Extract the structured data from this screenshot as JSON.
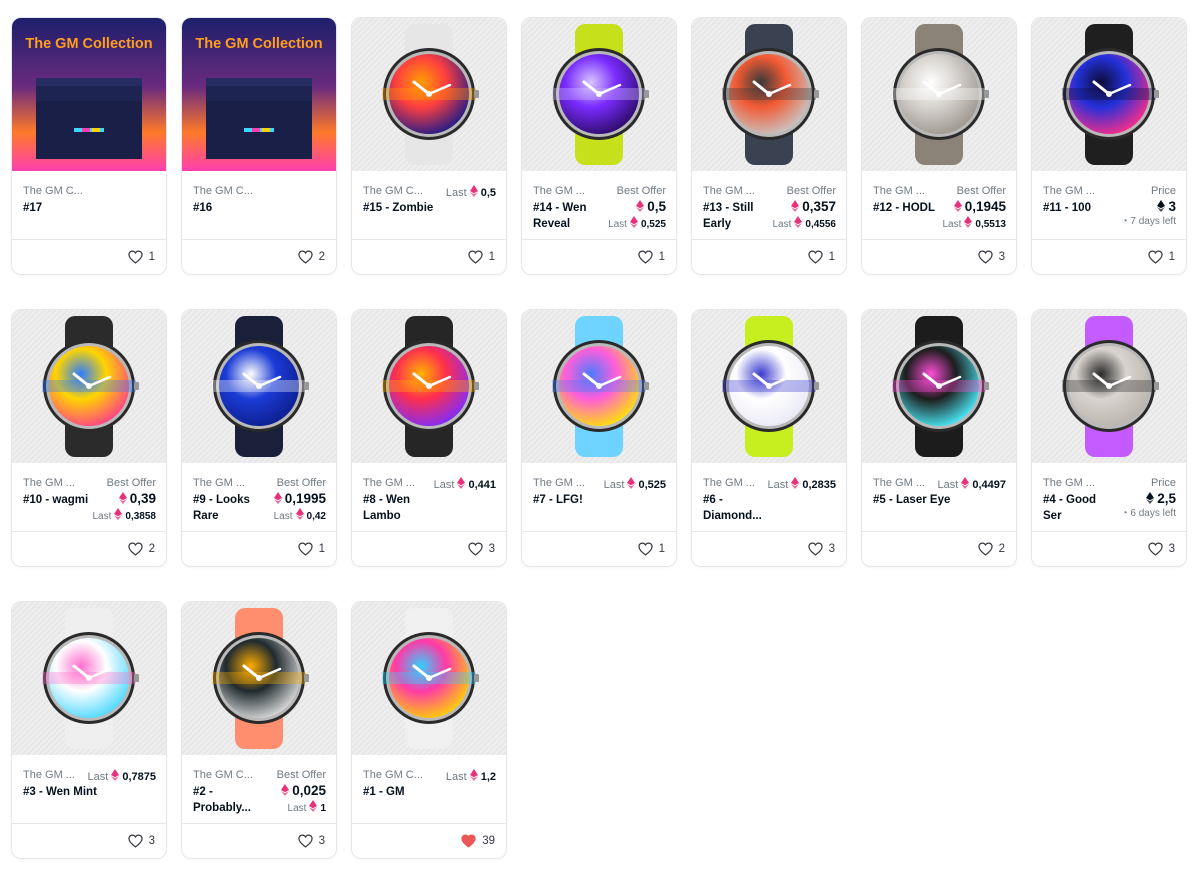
{
  "cards": [
    {
      "collection": "The GM C...",
      "name": "#17",
      "kind": "box",
      "box_title": "The GM Collection",
      "likes": "1",
      "liked": false
    },
    {
      "collection": "The GM C...",
      "name": "#16",
      "kind": "box",
      "box_title": "The GM Collection",
      "likes": "2",
      "liked": false
    },
    {
      "collection": "The GM C...",
      "name": "#15 - Zombie",
      "kind": "watch",
      "strap": "#e6e6e6",
      "dial": [
        "#ff3f3f",
        "#1b1b8a",
        "#ff9d00"
      ],
      "last_label": "Last",
      "last_value": "0,5",
      "likes": "1",
      "liked": false
    },
    {
      "collection": "The GM ...",
      "name": "#14 - Wen Reveal",
      "kind": "watch",
      "strap": "#c6e11b",
      "dial": [
        "#7a2cff",
        "#2b0a66",
        "#d7c6ff"
      ],
      "offer_label": "Best Offer",
      "price": "0,5",
      "last_label": "Last",
      "last_value": "0,525",
      "likes": "1",
      "liked": false
    },
    {
      "collection": "The GM ...",
      "name": "#13 - Still Early",
      "kind": "watch",
      "strap": "#3a4150",
      "dial": [
        "#f25a33",
        "#c7c7c7",
        "#3a3a3a"
      ],
      "offer_label": "Best Offer",
      "price": "0,357",
      "last_label": "Last",
      "last_value": "0,4556",
      "likes": "1",
      "liked": false
    },
    {
      "collection": "The GM ...",
      "name": "#12 - HODL",
      "kind": "watch",
      "strap": "#8b8377",
      "dial": [
        "#d7d3cf",
        "#9b958d",
        "#ffffff"
      ],
      "offer_label": "Best Offer",
      "price": "0,1945",
      "last_label": "Last",
      "last_value": "0,5513",
      "likes": "3",
      "liked": false
    },
    {
      "collection": "The GM ...",
      "name": "#11 - 100",
      "kind": "watch",
      "strap": "#1f1f1f",
      "dial": [
        "#2330d9",
        "#ff2d87",
        "#0d0d3a"
      ],
      "offer_label": "Price",
      "price": "3",
      "time_left": "7 days left",
      "likes": "1",
      "liked": false
    },
    {
      "collection": "The GM ...",
      "name": "#10 - wagmi",
      "kind": "watch",
      "strap": "#2b2b2b",
      "dial": [
        "#ffd500",
        "#ff3d8a",
        "#2c7cff"
      ],
      "offer_label": "Best Offer",
      "price": "0,39",
      "last_label": "Last",
      "last_value": "0,3858",
      "likes": "2",
      "liked": false
    },
    {
      "collection": "The GM ...",
      "name": "#9 - Looks Rare",
      "kind": "watch",
      "strap": "#1a1f3a",
      "dial": [
        "#1b3bd6",
        "#0c1e8c",
        "#ffffff"
      ],
      "offer_label": "Best Offer",
      "price": "0,1995",
      "last_label": "Last",
      "last_value": "0,42",
      "likes": "1",
      "liked": false
    },
    {
      "collection": "The GM ...",
      "name": "#8 - Wen Lambo",
      "kind": "watch",
      "strap": "#262626",
      "dial": [
        "#ff2e4d",
        "#7d2cff",
        "#ffb300"
      ],
      "last_label": "Last",
      "last_value": "0,441",
      "likes": "3",
      "liked": false
    },
    {
      "collection": "The GM ...",
      "name": "#7 - LFG!",
      "kind": "watch",
      "strap": "#6fd3ff",
      "dial": [
        "#ff5ed9",
        "#ffe600",
        "#4d7bff"
      ],
      "last_label": "Last",
      "last_value": "0,525",
      "likes": "1",
      "liked": false
    },
    {
      "collection": "The GM ...",
      "name": "#6 - Diamond...",
      "kind": "watch",
      "strap": "#c7ee1f",
      "dial": [
        "#ffffff",
        "#e9e9f5",
        "#3b3bd0"
      ],
      "last_label": "Last",
      "last_value": "0,2835",
      "likes": "3",
      "liked": false
    },
    {
      "collection": "The GM ...",
      "name": "#5 - Laser Eye",
      "kind": "watch",
      "strap": "#1c1c1c",
      "dial": [
        "#1d1d1d",
        "#4bf1ff",
        "#ff4dd8"
      ],
      "last_label": "Last",
      "last_value": "0,4497",
      "likes": "2",
      "liked": false
    },
    {
      "collection": "The GM ...",
      "name": "#4 - Good Ser",
      "kind": "watch",
      "strap": "#c45bff",
      "dial": [
        "#d9d4cf",
        "#b9b3ad",
        "#2a2a2a"
      ],
      "offer_label": "Price",
      "price": "2,5",
      "time_left": "6 days left",
      "likes": "3",
      "liked": false
    },
    {
      "collection": "The GM ...",
      "name": "#3 - Wen Mint",
      "kind": "watch",
      "strap": "#efefef",
      "dial": [
        "#ffffff",
        "#49d7ff",
        "#ff6fcf"
      ],
      "last_label": "Last",
      "last_value": "0,7875",
      "likes": "3",
      "liked": false
    },
    {
      "collection": "The GM C...",
      "name": "#2 - Probably...",
      "kind": "watch",
      "strap": "#ff8e6e",
      "dial": [
        "#1f2a2e",
        "#e0e0e0",
        "#ffae00"
      ],
      "offer_label": "Best Offer",
      "price": "0,025",
      "last_label": "Last",
      "last_value": "1",
      "likes": "3",
      "liked": false
    },
    {
      "collection": "The GM C...",
      "name": "#1 - GM",
      "kind": "watch",
      "strap": "#f0f0f0",
      "dial": [
        "#ff3aa7",
        "#ffd500",
        "#2fd1ff"
      ],
      "last_label": "Last",
      "last_value": "1,2",
      "likes": "39",
      "liked": true
    }
  ],
  "colors": {
    "heart_liked": "#eb5757",
    "eth_pink": "#e8317a",
    "eth_dark": "#04111d"
  }
}
